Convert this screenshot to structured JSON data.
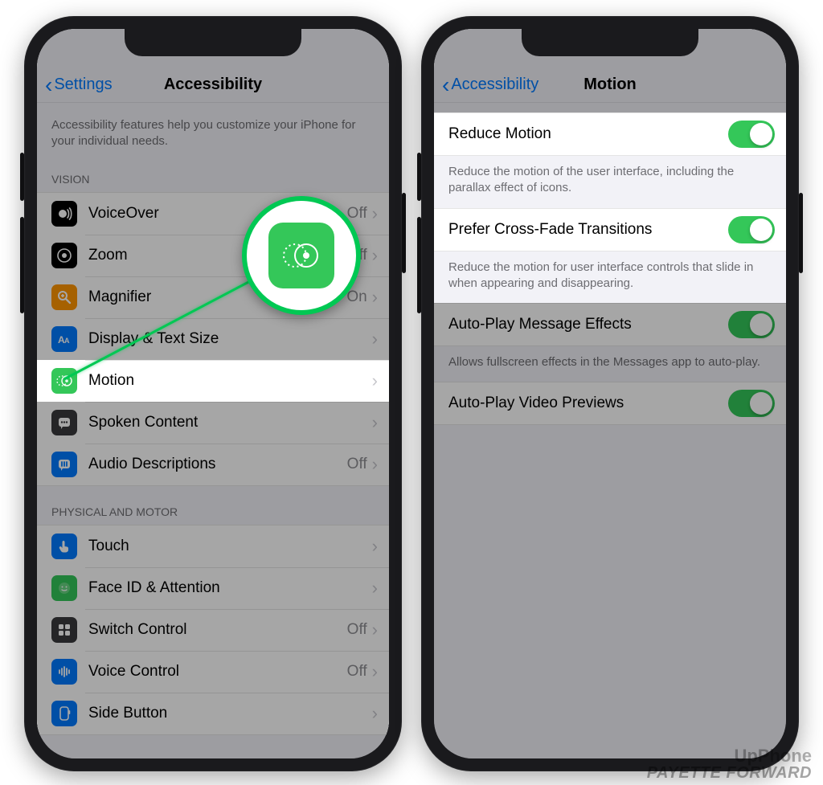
{
  "left": {
    "nav": {
      "back": "Settings",
      "title": "Accessibility"
    },
    "intro": "Accessibility features help you customize your iPhone for your individual needs.",
    "section_vision": "VISION",
    "section_motor": "PHYSICAL AND MOTOR",
    "vision_items": [
      {
        "label": "VoiceOver",
        "value": "Off",
        "icon": "voiceover-icon",
        "color": "ic-black"
      },
      {
        "label": "Zoom",
        "value": "Off",
        "icon": "zoom-icon",
        "color": "ic-black"
      },
      {
        "label": "Magnifier",
        "value": "On",
        "icon": "magnifier-icon",
        "color": "ic-orange"
      },
      {
        "label": "Display & Text Size",
        "value": "",
        "icon": "display-text-icon",
        "color": "ic-blue"
      },
      {
        "label": "Motion",
        "value": "",
        "icon": "motion-icon",
        "color": "ic-green"
      },
      {
        "label": "Spoken Content",
        "value": "",
        "icon": "spoken-content-icon",
        "color": "ic-darkgray"
      },
      {
        "label": "Audio Descriptions",
        "value": "Off",
        "icon": "audio-descriptions-icon",
        "color": "ic-blue"
      }
    ],
    "motor_items": [
      {
        "label": "Touch",
        "value": "",
        "icon": "touch-icon",
        "color": "ic-blue"
      },
      {
        "label": "Face ID & Attention",
        "value": "",
        "icon": "faceid-icon",
        "color": "ic-face"
      },
      {
        "label": "Switch Control",
        "value": "Off",
        "icon": "switch-control-icon",
        "color": "ic-darkgray"
      },
      {
        "label": "Voice Control",
        "value": "Off",
        "icon": "voice-control-icon",
        "color": "ic-blue"
      },
      {
        "label": "Side Button",
        "value": "",
        "icon": "side-button-icon",
        "color": "ic-blue"
      }
    ]
  },
  "right": {
    "nav": {
      "back": "Accessibility",
      "title": "Motion"
    },
    "rows": [
      {
        "label": "Reduce Motion",
        "on": true,
        "footer": "Reduce the motion of the user interface, including the parallax effect of icons."
      },
      {
        "label": "Prefer Cross-Fade Transitions",
        "on": true,
        "footer": "Reduce the motion for user interface controls that slide in when appearing and disappearing."
      },
      {
        "label": "Auto-Play Message Effects",
        "on": true,
        "footer": "Allows fullscreen effects in the Messages app to auto-play."
      },
      {
        "label": "Auto-Play Video Previews",
        "on": true,
        "footer": ""
      }
    ]
  },
  "watermark": {
    "line1": "UpPhone",
    "line2": "PAYETTE FORWARD"
  }
}
